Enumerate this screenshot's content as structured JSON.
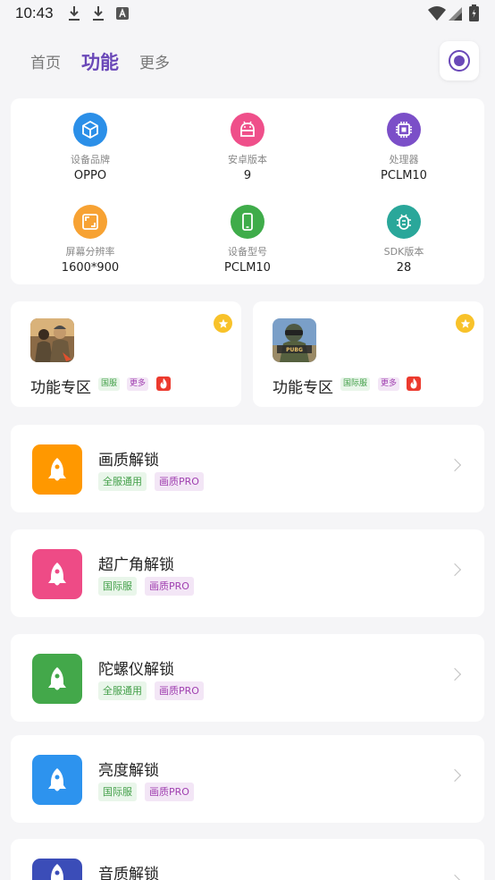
{
  "status_bar": {
    "time": "10:43"
  },
  "nav": {
    "tabs": [
      {
        "label": "首页",
        "active": false
      },
      {
        "label": "功能",
        "active": true
      },
      {
        "label": "更多",
        "active": false
      }
    ],
    "accent": "#6a48b8"
  },
  "device_info": [
    {
      "label": "设备品牌",
      "value": "OPPO",
      "icon": "cube-icon",
      "color": "#2b8fe8"
    },
    {
      "label": "安卓版本",
      "value": "9",
      "icon": "android-icon",
      "color": "#ef4f8a"
    },
    {
      "label": "处理器",
      "value": "PCLM10",
      "icon": "cpu-icon",
      "color": "#7b4fc8"
    },
    {
      "label": "屏幕分辨率",
      "value": "1600*900",
      "icon": "screen-resolution-icon",
      "color": "#f7a233"
    },
    {
      "label": "设备型号",
      "value": "PCLM10",
      "icon": "phone-icon",
      "color": "#3fac4a"
    },
    {
      "label": "SDK版本",
      "value": "28",
      "icon": "bug-icon",
      "color": "#2aa79a"
    }
  ],
  "promos": [
    {
      "title": "功能专区",
      "tag1": "国服",
      "tag2": "更多"
    },
    {
      "title": "功能专区",
      "tag1": "国际服",
      "tag2": "更多"
    }
  ],
  "features": [
    {
      "title": "画质解锁",
      "tag1": "全服通用",
      "tag2": "画质PRO",
      "color": "#ff9800"
    },
    {
      "title": "超广角解锁",
      "tag1": "国际服",
      "tag2": "画质PRO",
      "color": "#ee4b86"
    },
    {
      "title": "陀螺仪解锁",
      "tag1": "全服通用",
      "tag2": "画质PRO",
      "color": "#43a84a"
    },
    {
      "title": "亮度解锁",
      "tag1": "国际服",
      "tag2": "画质PRO",
      "color": "#2d93ee"
    },
    {
      "title": "音质解锁",
      "color": "#3b4db8"
    }
  ]
}
